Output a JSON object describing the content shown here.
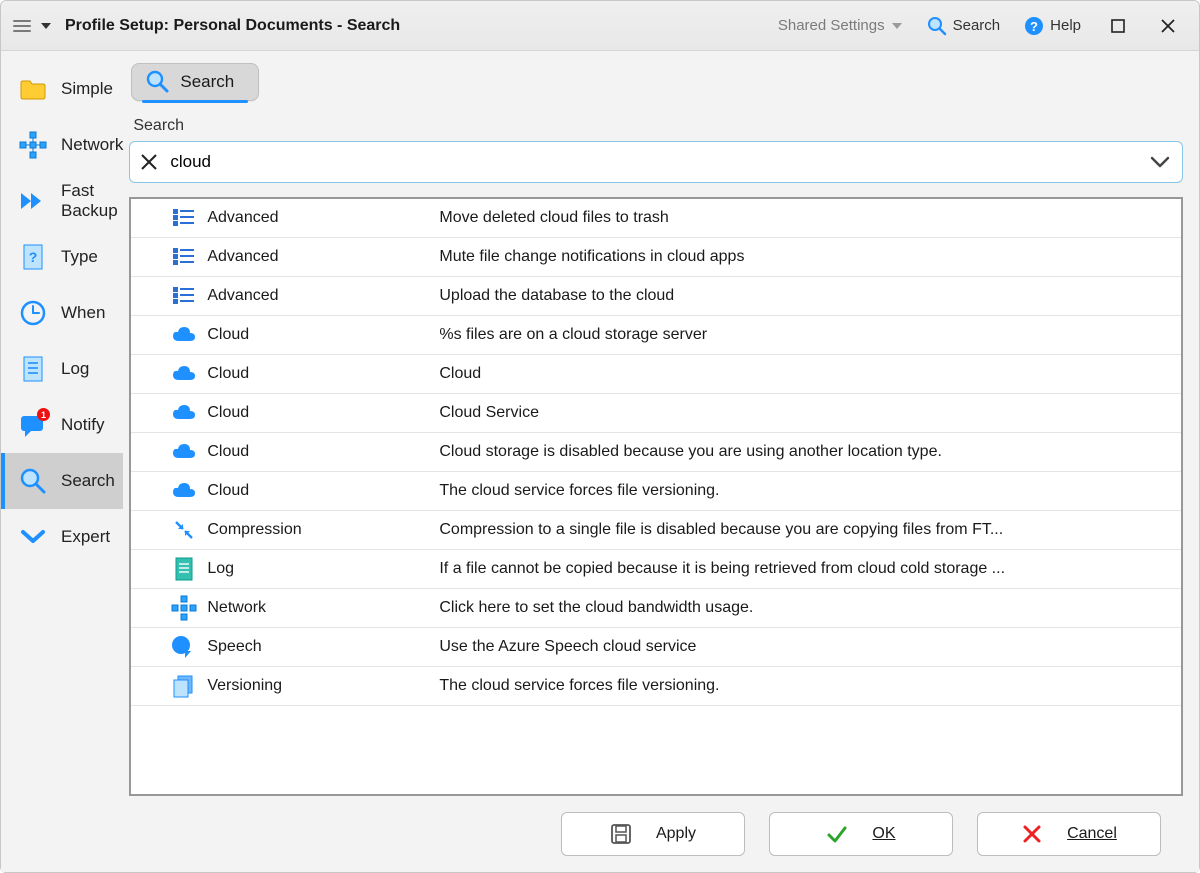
{
  "titlebar": {
    "title": "Profile Setup: Personal Documents - Search",
    "shared_settings": "Shared Settings",
    "search": "Search",
    "help": "Help"
  },
  "sidebar": {
    "items": [
      {
        "label": "Simple"
      },
      {
        "label": "Network"
      },
      {
        "label": "Fast Backup"
      },
      {
        "label": "Type"
      },
      {
        "label": "When"
      },
      {
        "label": "Log"
      },
      {
        "label": "Notify",
        "badge": "1"
      },
      {
        "label": "Search"
      },
      {
        "label": "Expert"
      }
    ]
  },
  "main": {
    "tab_label": "Search",
    "search_label": "Search",
    "search_value": "cloud",
    "results": [
      {
        "icon": "list",
        "category": "Advanced",
        "desc": "Move deleted cloud files to trash"
      },
      {
        "icon": "list",
        "category": "Advanced",
        "desc": "Mute file change notifications in cloud apps"
      },
      {
        "icon": "list",
        "category": "Advanced",
        "desc": "Upload the database to the cloud"
      },
      {
        "icon": "cloud",
        "category": "Cloud",
        "desc": "%s files are on a cloud storage server"
      },
      {
        "icon": "cloud",
        "category": "Cloud",
        "desc": "Cloud"
      },
      {
        "icon": "cloud",
        "category": "Cloud",
        "desc": "Cloud Service"
      },
      {
        "icon": "cloud",
        "category": "Cloud",
        "desc": "Cloud storage is disabled because you are using another location type."
      },
      {
        "icon": "cloud",
        "category": "Cloud",
        "desc": "The cloud service forces file versioning."
      },
      {
        "icon": "compress",
        "category": "Compression",
        "desc": "Compression to a single file is disabled because you are copying files from FT..."
      },
      {
        "icon": "log",
        "category": "Log",
        "desc": "If a file cannot be copied because it is being retrieved from cloud cold storage ..."
      },
      {
        "icon": "network",
        "category": "Network",
        "desc": "Click here to set the cloud bandwidth usage."
      },
      {
        "icon": "speech",
        "category": "Speech",
        "desc": "Use the Azure Speech cloud service"
      },
      {
        "icon": "version",
        "category": "Versioning",
        "desc": "The cloud service forces file versioning."
      }
    ]
  },
  "footer": {
    "apply": "Apply",
    "ok": "OK",
    "cancel": "Cancel"
  }
}
